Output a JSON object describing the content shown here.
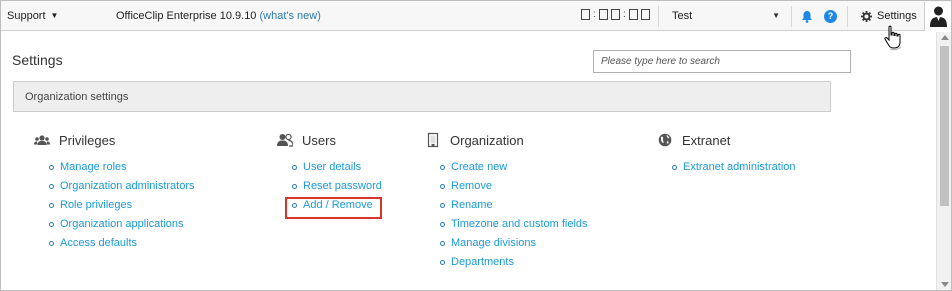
{
  "topbar": {
    "support_label": "Support",
    "app_name": "OfficeClip Enterprise 10.9.10",
    "whats_new": "(what's new)",
    "selected_org": "Test",
    "settings_label": "Settings"
  },
  "page": {
    "title": "Settings",
    "search_placeholder": "Please type here to search",
    "org_bar_label": "Organization settings"
  },
  "sections": {
    "privileges": {
      "title": "Privileges",
      "icon": "users-group-icon",
      "links": [
        "Manage roles",
        "Organization administrators",
        "Role privileges",
        "Organization applications",
        "Access defaults"
      ]
    },
    "users": {
      "title": "Users",
      "icon": "user-pair-icon",
      "links": [
        "User details",
        "Reset password",
        "Add / Remove"
      ]
    },
    "organization": {
      "title": "Organization",
      "icon": "building-icon",
      "links": [
        "Create new",
        "Remove",
        "Rename",
        "Timezone and custom fields",
        "Manage divisions",
        "Departments"
      ]
    },
    "extranet": {
      "title": "Extranet",
      "icon": "globe-icon",
      "links": [
        "Extranet administration"
      ]
    }
  },
  "colors": {
    "link": "#1a9ad6",
    "highlight": "#d9342b",
    "help_icon": "#1e88e5"
  }
}
